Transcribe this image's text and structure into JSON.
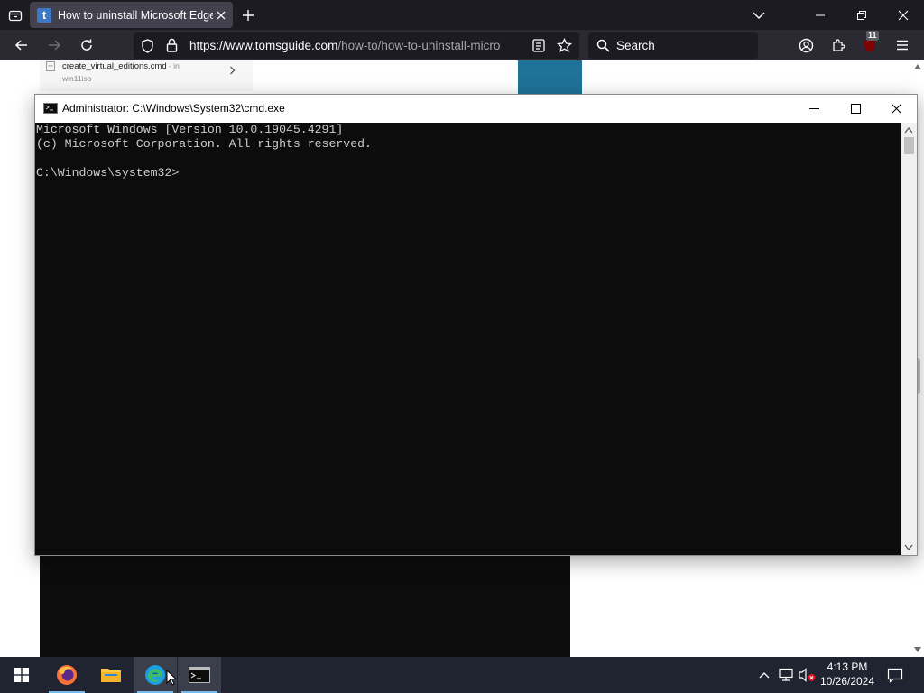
{
  "browser": {
    "tab_title": "How to uninstall Microsoft Edge",
    "tab_favicon_letter": "t",
    "url_host": "https://www.tomsguide.com",
    "url_path": "/how-to/how-to-uninstall-micro",
    "search_placeholder": "Search",
    "extensions_badge": "11"
  },
  "page": {
    "file_name": "create_virtual_editions.cmd",
    "file_meta": " - in",
    "file_sub": "win11iso"
  },
  "cmd": {
    "title": "Administrator: C:\\Windows\\System32\\cmd.exe",
    "lines": [
      "Microsoft Windows [Version 10.0.19045.4291]",
      "(c) Microsoft Corporation. All rights reserved.",
      "",
      "C:\\Windows\\system32>"
    ]
  },
  "taskbar": {
    "apps": [
      "start-icon",
      "firefox-icon",
      "file-explorer-icon",
      "edge-icon",
      "cmd-icon"
    ],
    "time": "4:13 PM",
    "date": "10/26/2024"
  },
  "colors": {
    "browser_tabbar": "#1c1b22",
    "browser_toolbar": "#2b2a33",
    "console_bg": "#0c0c0c",
    "console_fg": "#cccccc",
    "taskbar": "#1f2430",
    "accent": "#76b9ed"
  }
}
